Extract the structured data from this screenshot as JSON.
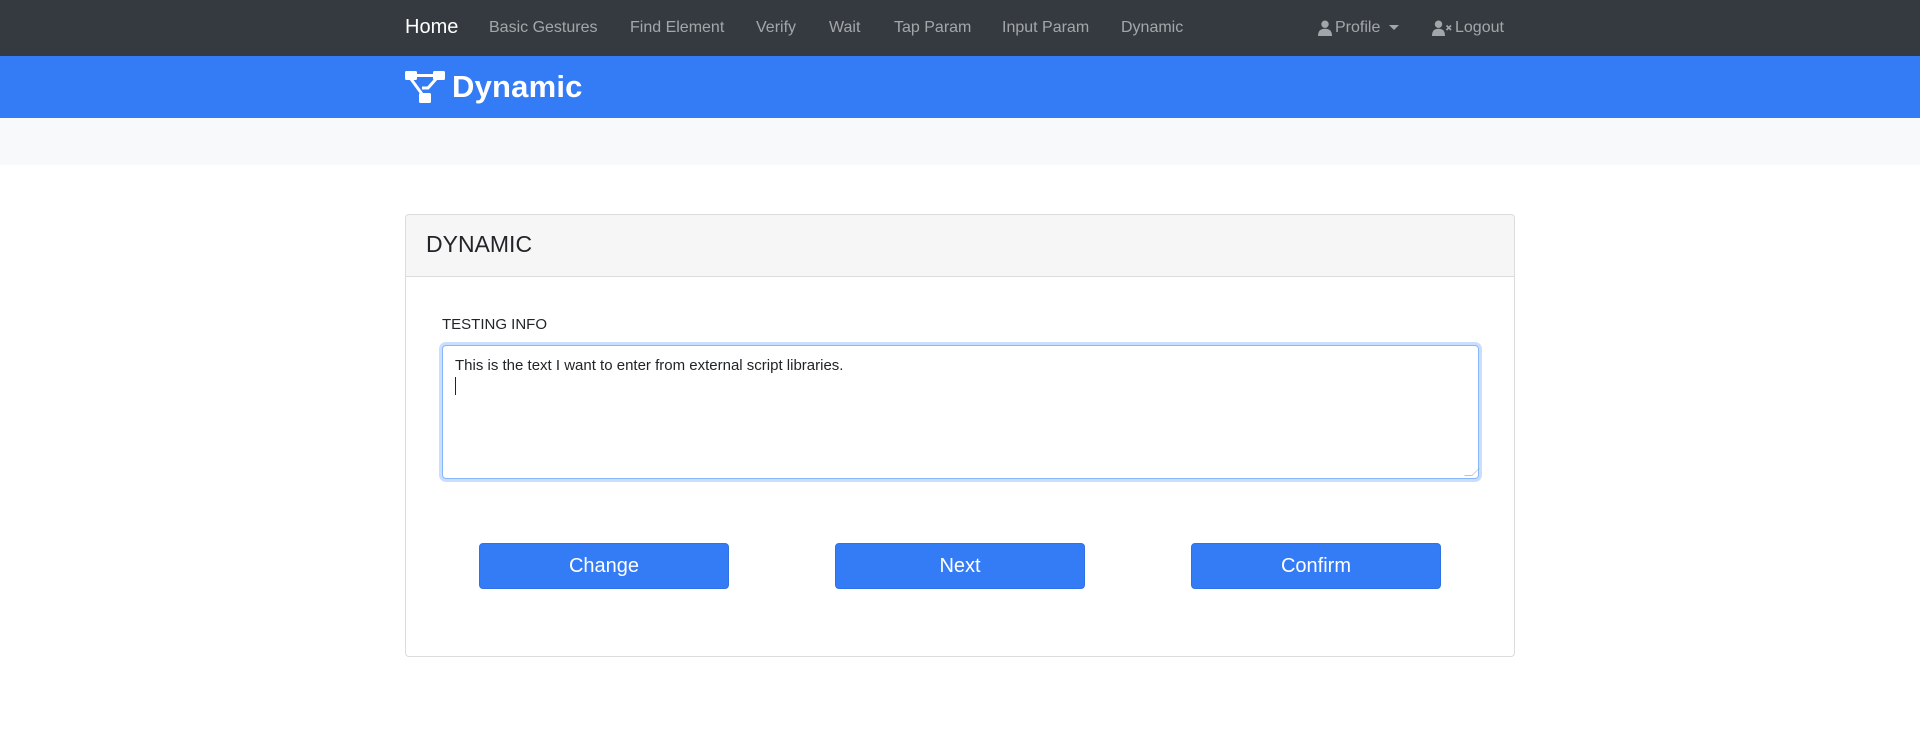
{
  "nav": {
    "brand": "Home",
    "links": [
      "Basic Gestures",
      "Find Element",
      "Verify",
      "Wait",
      "Tap Param",
      "Input Param",
      "Dynamic"
    ],
    "profile_label": "Profile",
    "logout_label": "Logout"
  },
  "banner": {
    "title": "Dynamic"
  },
  "card": {
    "title": "DYNAMIC",
    "field_label": "TESTING INFO",
    "textarea_value": "This is the text I want to enter from external script libraries.",
    "buttons": [
      "Change",
      "Next",
      "Confirm"
    ]
  },
  "colors": {
    "navbar": "#343a40",
    "accent": "#347bf6",
    "subbar": "#f8f9fa"
  }
}
